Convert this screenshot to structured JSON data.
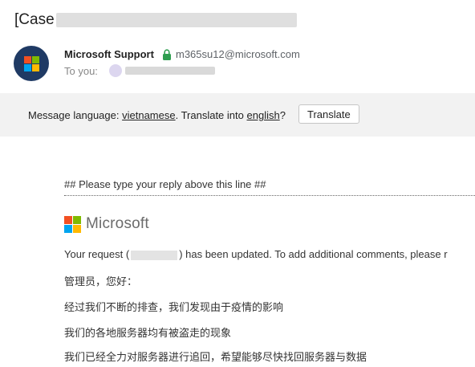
{
  "email": {
    "subject_prefix": "[Case",
    "sender_name": "Microsoft Support",
    "sender_email": "m365su12@microsoft.com",
    "to_label": "To you:"
  },
  "translate_bar": {
    "prefix": "Message language:",
    "source_language": "vietnamese",
    "middle": ". Translate into",
    "target_language": "english",
    "suffix": "?",
    "button_label": "Translate"
  },
  "body": {
    "reply_line": "## Please type your reply above this line ##",
    "logo_text": "Microsoft",
    "request_before": "Your request (",
    "request_after": ") has been updated. To add additional comments, please r",
    "greeting": "管理员，您好：",
    "line1": "经过我们不断的排查，我们发现由于疫情的影响",
    "line2": "我们的各地服务器均有被盗走的现象",
    "line3": "我们已经全力对服务器进行追回，希望能够尽快找回服务器与数据"
  },
  "colors": {
    "avatar_bg": "#1f3a64",
    "ms_red": "#f25022",
    "ms_green": "#7fba00",
    "ms_blue": "#00a4ef",
    "ms_yellow": "#ffb900",
    "lock_green": "#2e9e4f",
    "translate_bar_bg": "#f2f2f2"
  }
}
